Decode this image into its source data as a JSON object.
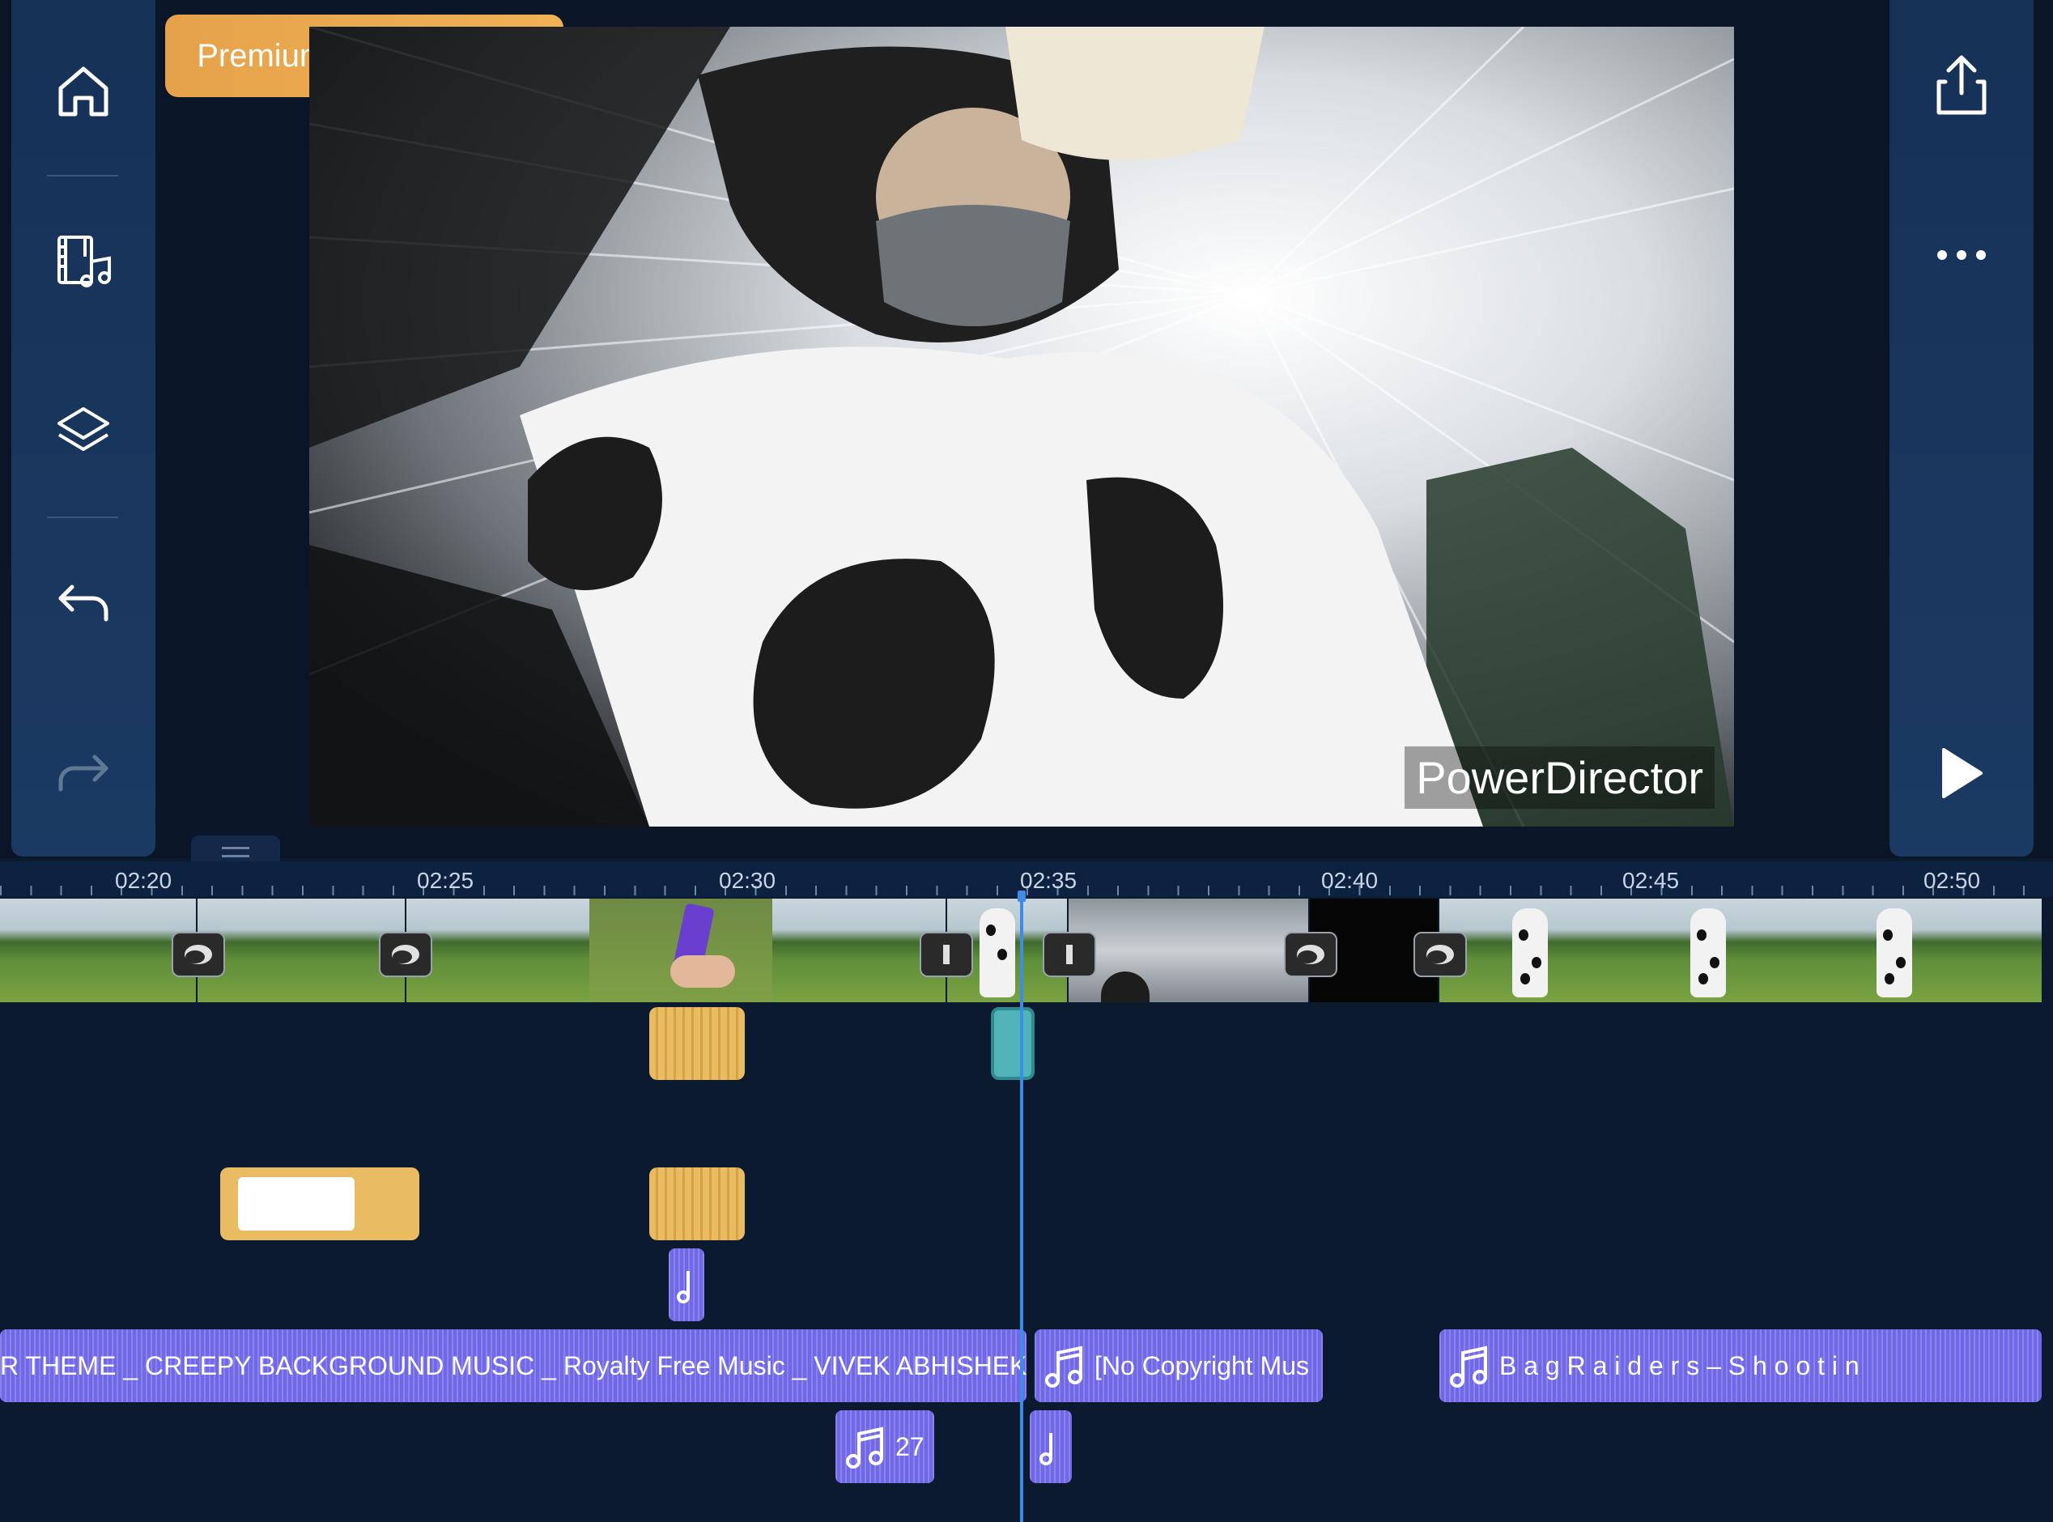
{
  "app": {
    "name": "PowerDirector"
  },
  "premium_badge": {
    "label": "Premium features used"
  },
  "preview": {
    "watermark": "PowerDirector"
  },
  "left_toolbar": {
    "items": [
      {
        "name": "home",
        "icon": "home-icon"
      },
      {
        "name": "media",
        "icon": "media-music-icon"
      },
      {
        "name": "layers",
        "icon": "layers-icon"
      },
      {
        "name": "undo",
        "icon": "undo-icon"
      },
      {
        "name": "redo",
        "icon": "redo-icon",
        "disabled": true
      }
    ]
  },
  "right_toolbar": {
    "items": [
      {
        "name": "export",
        "icon": "share-export-icon"
      },
      {
        "name": "more",
        "icon": "more-icon"
      },
      {
        "name": "play",
        "icon": "play-icon"
      }
    ]
  },
  "timeline": {
    "ruler_labels": [
      "02:20",
      "02:25",
      "02:30",
      "02:35",
      "02:40",
      "02:45",
      "02:50"
    ],
    "audio_tracks": [
      {
        "name": "audio-clip-creepy",
        "title": "R THEME _ CREEPY BACKGROUND MUSIC _ Royalty Free Music _ VIVEK ABHISHEK.m"
      },
      {
        "name": "audio-clip-no-copyright",
        "title": "[No Copyright Mus"
      },
      {
        "name": "audio-clip-bag-raiders",
        "title": "B a g   R a i d e r s  –  S h o o t i n"
      },
      {
        "name": "audio-clip-27",
        "title": "27"
      }
    ]
  },
  "colors": {
    "accent": "#3d8de8",
    "panel": "#1b3a63",
    "premium": "#e9a84f",
    "audio": "#7168e8",
    "effect": "#e9bb62",
    "effect_selected": "#4fb3b8"
  }
}
